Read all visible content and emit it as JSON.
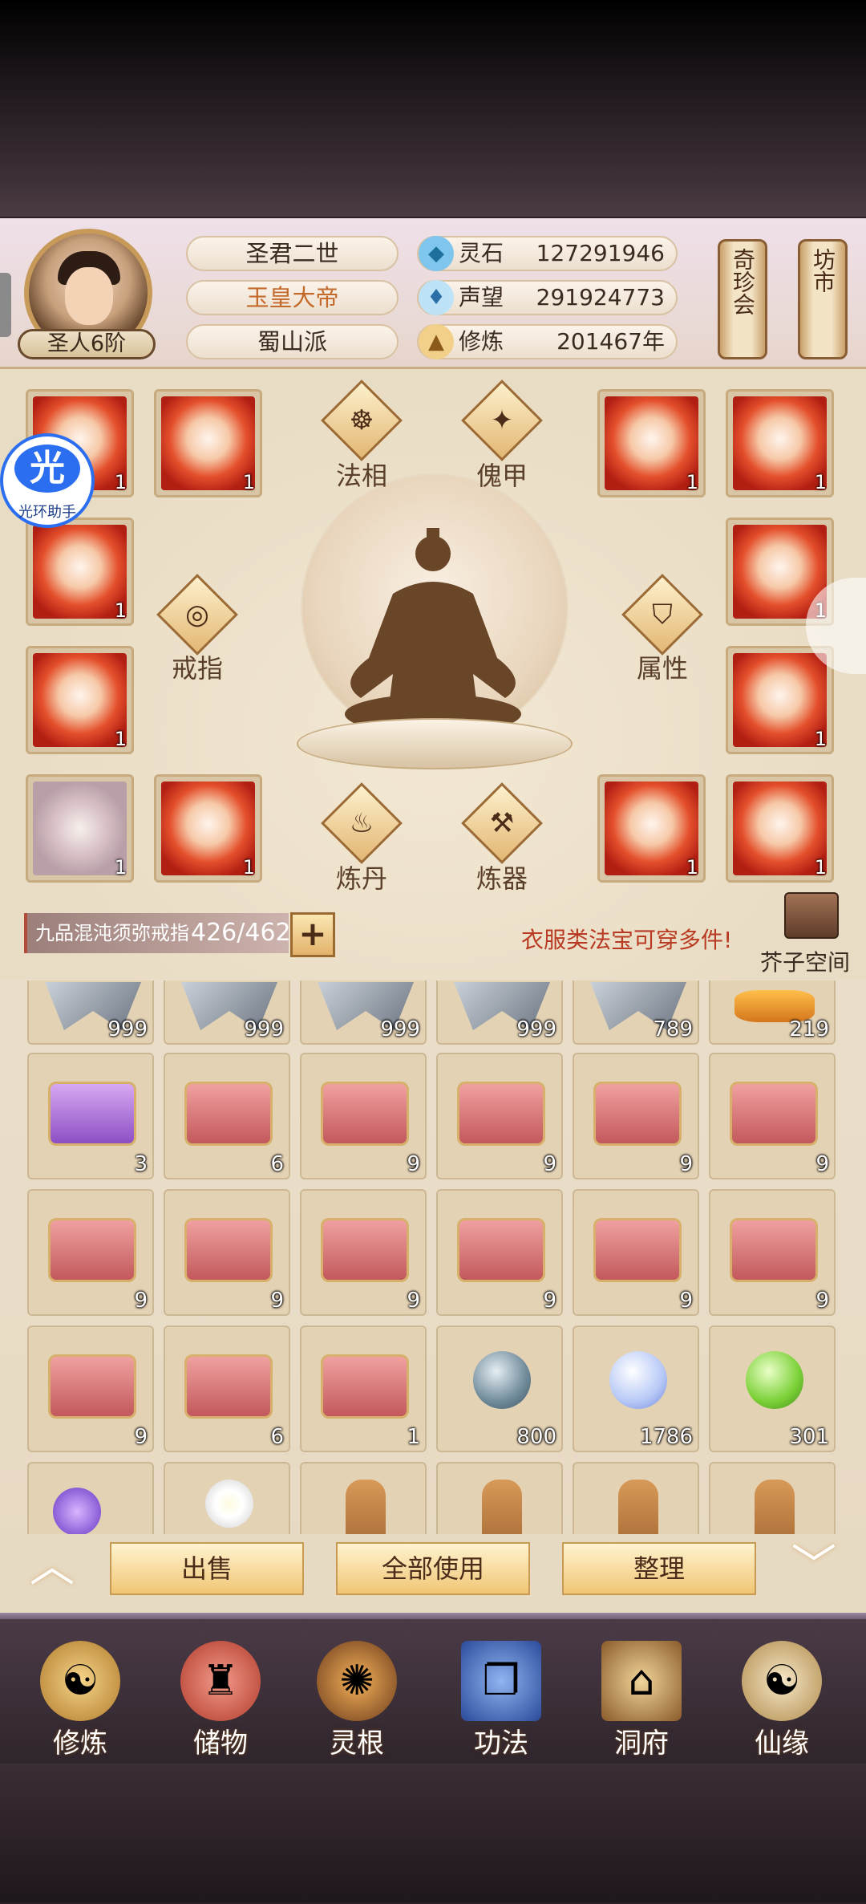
{
  "player": {
    "rank": "圣人6阶",
    "name": "圣君二世",
    "title": "玉皇大帝",
    "sect": "蜀山派"
  },
  "stats": [
    {
      "icon": "spirit-stone-icon",
      "label": "灵石",
      "value": "127291946"
    },
    {
      "icon": "prestige-icon",
      "label": "声望",
      "value": "291924773"
    },
    {
      "icon": "cultivation-icon",
      "label": "修炼",
      "value": "201467年"
    }
  ],
  "scrolls": {
    "treasure": "奇珍会",
    "market": "坊市"
  },
  "helper": {
    "glyph": "光",
    "label": "光环助手"
  },
  "equip": {
    "slots_left": [
      {
        "count": "1"
      },
      {
        "count": "1"
      },
      {
        "count": "1"
      },
      {
        "count": "1"
      },
      {
        "count": "1"
      },
      {
        "count": "1"
      }
    ],
    "slots_right": [
      {
        "count": "1"
      },
      {
        "count": "1"
      },
      {
        "count": "1"
      },
      {
        "count": "1"
      },
      {
        "count": "1"
      },
      {
        "count": "1"
      }
    ],
    "functions": {
      "faxiang": "法相",
      "kuijia": "傀甲",
      "ring": "戒指",
      "attr": "属性",
      "alchemy": "炼丹",
      "forge": "炼器"
    }
  },
  "bag": {
    "ring_name": "九品混沌须弥戒指",
    "capacity": "426/462",
    "add": "+",
    "hint": "衣服类法宝可穿多件!",
    "storage_label": "芥子空间"
  },
  "inventory": {
    "row0": [
      "999",
      "999",
      "999",
      "999",
      "789",
      "219"
    ],
    "row1": [
      "3",
      "6",
      "9",
      "9",
      "9",
      "9"
    ],
    "row2": [
      "9",
      "9",
      "9",
      "9",
      "9",
      "9"
    ],
    "row3": [
      "9",
      "6",
      "1",
      "800",
      "1786",
      "301"
    ]
  },
  "actions": {
    "sell": "出售",
    "use_all": "全部使用",
    "sort": "整理"
  },
  "nav": [
    {
      "label": "修炼"
    },
    {
      "label": "储物"
    },
    {
      "label": "灵根"
    },
    {
      "label": "功法"
    },
    {
      "label": "洞府"
    },
    {
      "label": "仙缘"
    }
  ],
  "colors": {
    "accent_gold": "#f1c675",
    "hint_red": "#b83a22",
    "title_orange": "#c46a2a"
  }
}
